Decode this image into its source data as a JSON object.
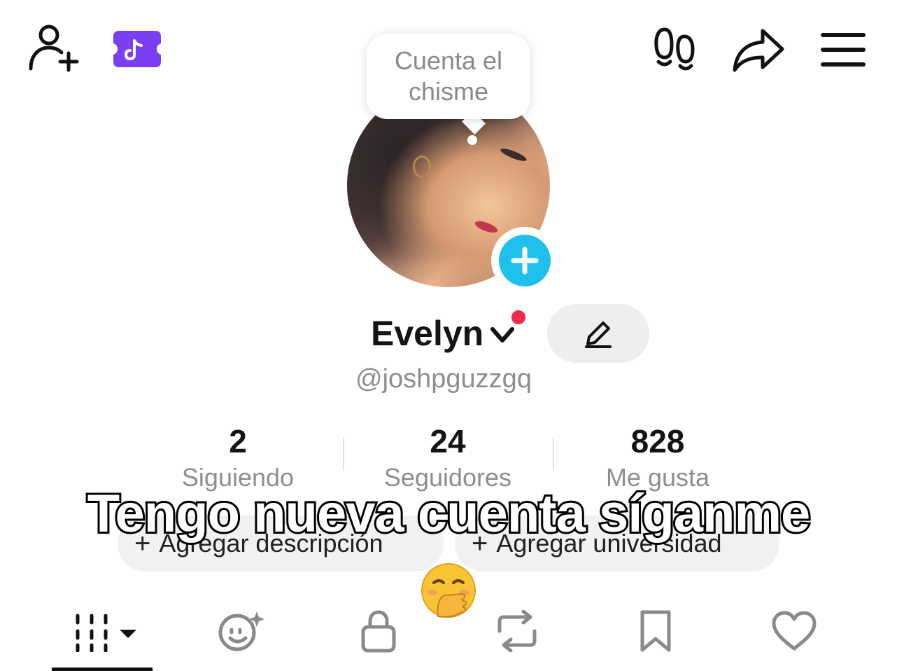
{
  "tooltip": {
    "text": "Cuenta el\nchisme"
  },
  "profile": {
    "display_name": "Evelyn",
    "username": "@joshpguzzgq"
  },
  "stats": [
    {
      "value": "2",
      "label": "Siguiendo"
    },
    {
      "value": "24",
      "label": "Seguidores"
    },
    {
      "value": "828",
      "label": "Me gusta"
    }
  ],
  "pills": {
    "description": "Agregar descripción",
    "university": "Agregar universidad",
    "plus_glyph": "+"
  },
  "overlay": {
    "caption": "Tengo nueva cuenta síganme",
    "emoji": "🤭"
  },
  "icons": {
    "top_left": [
      "add-friend-icon",
      "promo-ticket-icon"
    ],
    "top_right": [
      "footprints-icon",
      "share-icon",
      "menu-icon"
    ],
    "tabs": [
      "videos-grid-icon",
      "ai-avatar-icon",
      "lock-icon",
      "repost-icon",
      "bookmark-icon",
      "heart-icon"
    ]
  },
  "colors": {
    "accent_blue": "#20c0ec",
    "notification_red": "#f2284e",
    "promo_purple": "#7b3ff2"
  }
}
